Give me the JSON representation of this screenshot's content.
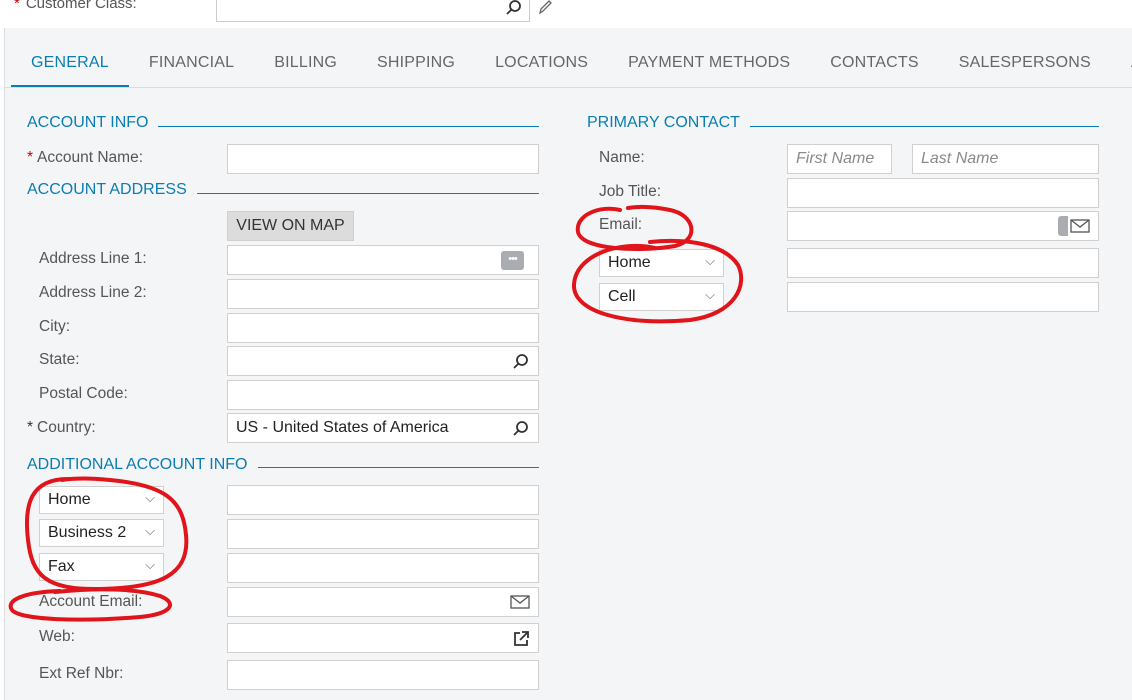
{
  "top": {
    "customer_class_label": "Customer Class:"
  },
  "tabs": [
    {
      "label": "GENERAL"
    },
    {
      "label": "FINANCIAL"
    },
    {
      "label": "BILLING"
    },
    {
      "label": "SHIPPING"
    },
    {
      "label": "LOCATIONS"
    },
    {
      "label": "PAYMENT METHODS"
    },
    {
      "label": "CONTACTS"
    },
    {
      "label": "SALESPERSONS"
    },
    {
      "label": "A"
    }
  ],
  "account_info": {
    "header": "ACCOUNT INFO",
    "account_name_label": "Account Name:"
  },
  "account_address": {
    "header": "ACCOUNT ADDRESS",
    "view_on_map": "VIEW ON MAP",
    "address_line1_label": "Address Line 1:",
    "address_line2_label": "Address Line 2:",
    "city_label": "City:",
    "state_label": "State:",
    "postal_code_label": "Postal Code:",
    "country_label": "Country:",
    "country_value": "US - United States of America"
  },
  "additional_info": {
    "header": "ADDITIONAL ACCOUNT INFO",
    "phone1_type": "Home",
    "phone2_type": "Business 2",
    "fax_type": "Fax",
    "account_email_label": "Account Email:",
    "web_label": "Web:",
    "ext_ref_label": "Ext Ref Nbr:"
  },
  "primary_contact": {
    "header": "PRIMARY CONTACT",
    "name_label": "Name:",
    "first_name_placeholder": "First Name",
    "last_name_placeholder": "Last Name",
    "job_title_label": "Job Title:",
    "email_label": "Email:",
    "phone1_type": "Home",
    "phone2_type": "Cell"
  },
  "colors": {
    "accent": "#0a7db3",
    "required": "#cc0000",
    "annotation": "#e0141b"
  }
}
